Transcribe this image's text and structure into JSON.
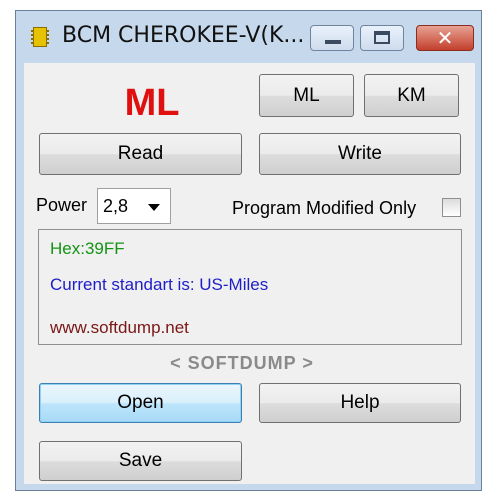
{
  "window": {
    "title": "BCM CHEROKEE-V(K...",
    "close_glyph": "✕"
  },
  "main": {
    "mode_label": "ML",
    "ml_button": "ML",
    "km_button": "KM",
    "read_button": "Read",
    "write_button": "Write",
    "power_label": "Power",
    "power_value": "2,8",
    "program_modified_label": "Program Modified Only",
    "program_modified_checked": false,
    "info_hex": "Hex:39FF",
    "info_standard": "Current standart is: US-Miles",
    "info_url": "www.softdump.net",
    "brand": "< SOFTDUMP >",
    "open_button": "Open",
    "help_button": "Help",
    "save_button": "Save"
  },
  "colors": {
    "mode_label": "#e01010",
    "hex_text": "#139413",
    "standard_text": "#1e1ec8",
    "url_text": "#7a1616"
  }
}
